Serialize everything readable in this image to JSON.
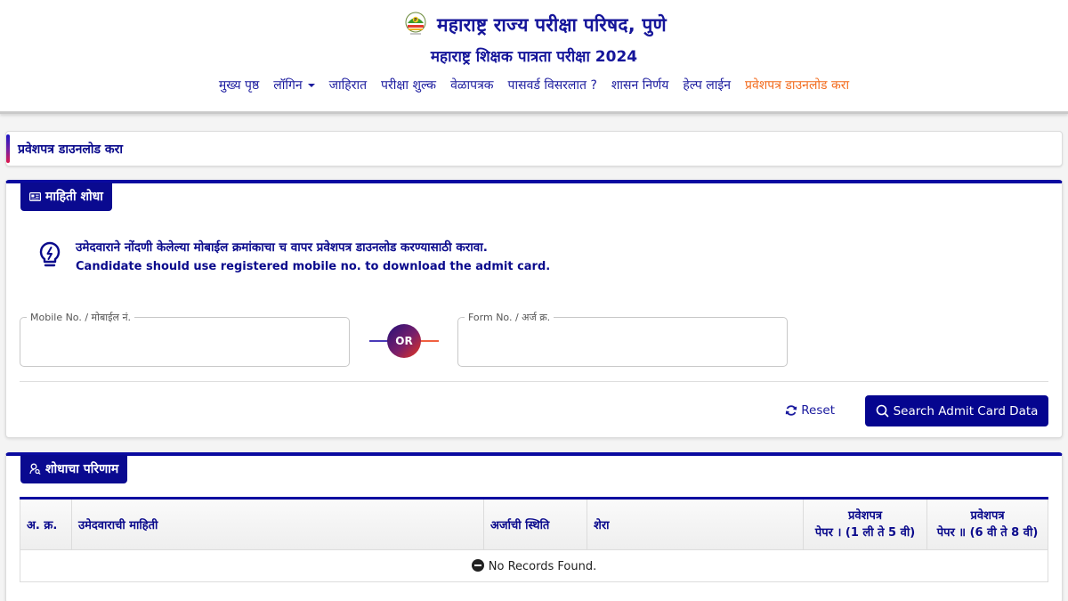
{
  "header": {
    "org_title": "महाराष्ट्र राज्य परीक्षा परिषद, पुणे",
    "exam_title": "महाराष्ट्र शिक्षक पात्रता परीक्षा 2024",
    "logo_icon": "msce-logo"
  },
  "nav": {
    "items": [
      {
        "label": "मुख्य पृष्ठ",
        "active": false,
        "dropdown": false
      },
      {
        "label": "लॉगिन",
        "active": false,
        "dropdown": true
      },
      {
        "label": "जाहिरात",
        "active": false,
        "dropdown": false
      },
      {
        "label": "परीक्षा शुल्क",
        "active": false,
        "dropdown": false
      },
      {
        "label": "वेळापत्रक",
        "active": false,
        "dropdown": false
      },
      {
        "label": "पासवर्ड विसरलात ?",
        "active": false,
        "dropdown": false
      },
      {
        "label": "शासन निर्णय",
        "active": false,
        "dropdown": false
      },
      {
        "label": "हेल्प लाईन",
        "active": false,
        "dropdown": false
      },
      {
        "label": "प्रवेशपत्र डाउनलोड करा",
        "active": true,
        "dropdown": false
      }
    ],
    "active_color": "#f26b1d",
    "text_color": "#1a1a9e"
  },
  "breadcrumb": {
    "title": "प्रवेशपत्र डाउनलोड करा"
  },
  "search_panel": {
    "tab_label": "माहिती शोधा",
    "tab_icon": "id-card-icon",
    "info_marathi": "उमेदवाराने नोंदणी केलेल्या मोबाईल क्रमांकाचा च वापर प्रवेशपत्र डाउनलोड करण्यासाठी करावा.",
    "info_english": "Candidate should use registered mobile no. to download the admit card.",
    "info_icon": "lightbulb-icon",
    "mobile_field": {
      "label": "Mobile No. / मोबाईल नं.",
      "value": "",
      "placeholder": ""
    },
    "or_label": "OR",
    "form_field": {
      "label": "Form No. / अर्ज क्र.",
      "value": "",
      "placeholder": ""
    },
    "reset_label": "Reset",
    "search_label": "Search Admit Card Data"
  },
  "results_panel": {
    "tab_label": "शोधाचा परिणाम",
    "tab_icon": "user-search-icon",
    "columns": [
      "अ. क्र.",
      "उमेदवाराची माहिती",
      "अर्जाची स्थिति",
      "शेरा",
      "प्रवेशपत्र\nपेपर । (1 ली ते 5 वी)",
      "प्रवेशपत्र\nपेपर ॥ (6 वी ते 8 वी)"
    ],
    "column_lines": [
      [
        "अ. क्र."
      ],
      [
        "उमेदवाराची माहिती"
      ],
      [
        "अर्जाची स्थिति"
      ],
      [
        "शेरा"
      ],
      [
        "प्रवेशपत्र",
        "पेपर । (1 ली ते 5 वी)"
      ],
      [
        "प्रवेशपत्र",
        "पेपर ॥ (6 वी ते 8 वी)"
      ]
    ],
    "empty_message": "No Records Found."
  },
  "colors": {
    "primary": "#0a0a90",
    "accent": "#f26b1d"
  }
}
